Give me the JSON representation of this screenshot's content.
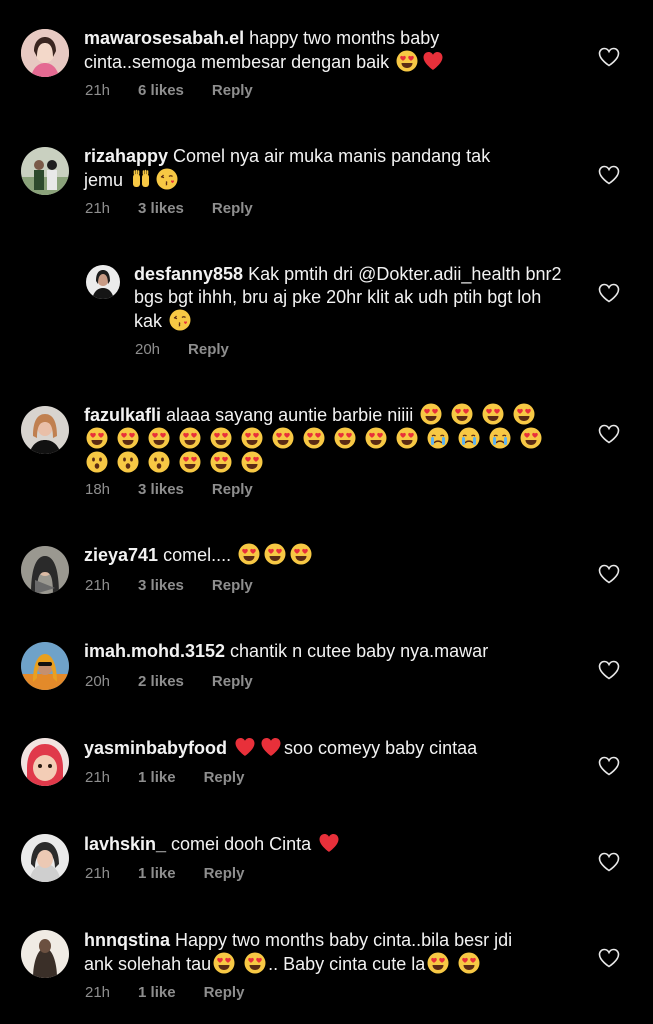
{
  "comments": [
    {
      "username": "mawarosesabah.el",
      "text": "happy two months baby cinta..semoga membesar dengan baik",
      "emojis": [
        "heart-eyes-emoji",
        "red-heart-emoji"
      ],
      "time": "21h",
      "likes": "6 likes",
      "reply": "Reply"
    },
    {
      "username": "rizahappy",
      "text": "Comel nya air muka manis pandang tak jemu",
      "emojis": [
        "raised-hands-emoji",
        "kiss-emoji"
      ],
      "time": "21h",
      "likes": "3 likes",
      "reply": "Reply"
    },
    {
      "username": "desfanny858",
      "text": "Kak pmtih dri @Dokter.adii_health bnr2 bgs bgt ihhh, bru aj pke 20hr klit ak udh ptih bgt loh kak",
      "emojis": [
        "kiss-emoji"
      ],
      "time": "20h",
      "reply": "Reply"
    },
    {
      "username": "fazulkafli",
      "text": "alaaa sayang auntie barbie niiii",
      "emojis": [
        "heart-eyes-emoji",
        "heart-eyes-emoji",
        "heart-eyes-emoji",
        "heart-eyes-emoji",
        "heart-eyes-emoji",
        "heart-eyes-emoji",
        "heart-eyes-emoji",
        "heart-eyes-emoji",
        "heart-eyes-emoji",
        "heart-eyes-emoji",
        "heart-eyes-emoji",
        "heart-eyes-emoji",
        "heart-eyes-emoji",
        "heart-eyes-emoji",
        "heart-eyes-emoji",
        "crying-emoji",
        "crying-emoji",
        "crying-emoji",
        "heart-eyes-emoji",
        "surprised-emoji",
        "surprised-emoji",
        "surprised-emoji",
        "heart-eyes-emoji",
        "heart-eyes-emoji",
        "heart-eyes-emoji"
      ],
      "time": "18h",
      "likes": "3 likes",
      "reply": "Reply"
    },
    {
      "username": "zieya741",
      "text": "comel....",
      "emojis": [
        "heart-eyes-emoji",
        "heart-eyes-emoji",
        "heart-eyes-emoji"
      ],
      "time": "21h",
      "likes": "3 likes",
      "reply": "Reply"
    },
    {
      "username": "imah.mohd.3152",
      "text": "chantik n cutee baby nya.mawar",
      "emojis": [],
      "time": "20h",
      "likes": "2 likes",
      "reply": "Reply"
    },
    {
      "username": "yasminbabyfood",
      "text": "soo comeyy baby cintaa",
      "emojis_before": [
        "red-heart-emoji",
        "red-heart-emoji"
      ],
      "time": "21h",
      "likes": "1 like",
      "reply": "Reply"
    },
    {
      "username": "lavhskin_",
      "text": "comei dooh Cinta",
      "emojis": [
        "red-heart-emoji"
      ],
      "time": "21h",
      "likes": "1 like",
      "reply": "Reply"
    },
    {
      "username": "hnnqstina",
      "text_a": "Happy two months baby cinta..bila besr jdi ank solehah tau",
      "text_b": ".. Baby cinta cute la",
      "time": "21h",
      "likes": "1 like",
      "reply": "Reply"
    }
  ],
  "colors": {
    "background": "#000000",
    "text": "#f2f2f2",
    "meta": "#8e8e8e"
  }
}
